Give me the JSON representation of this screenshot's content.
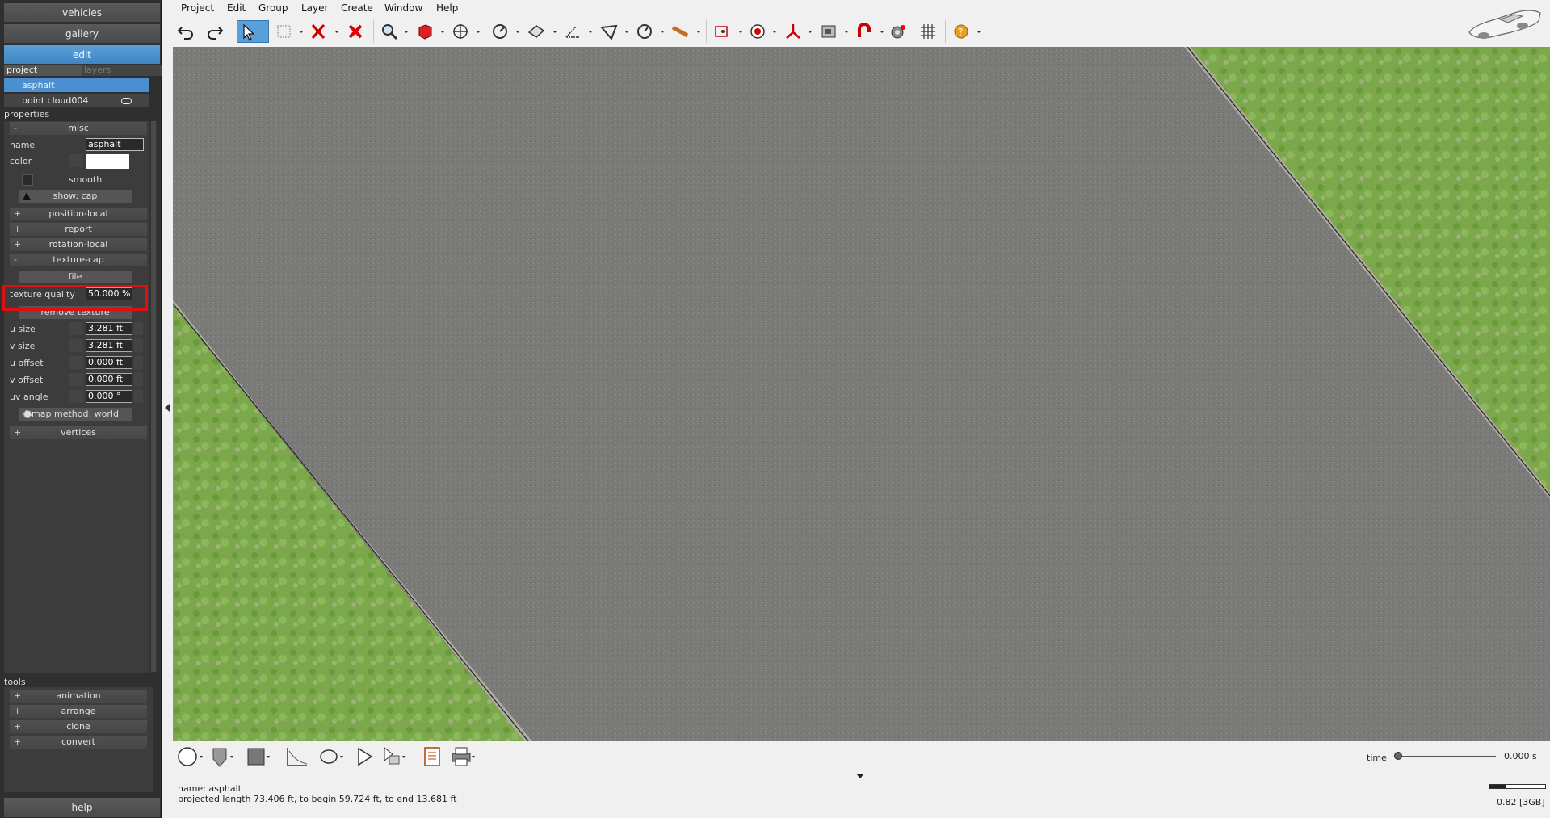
{
  "left_panel": {
    "top_buttons": [
      "vehicles",
      "gallery",
      "edit"
    ],
    "tabs": {
      "project": "project",
      "layers": "layers"
    },
    "layers": [
      "asphalt",
      "point cloud004"
    ],
    "properties_header": "properties",
    "misc_header": "misc",
    "name_label": "name",
    "name_value": "asphalt",
    "color_label": "color",
    "color_value": "#ffffff",
    "smooth_label": "smooth",
    "show_cap": "show: cap",
    "sections": [
      "position-local",
      "report",
      "rotation-local",
      "texture-cap"
    ],
    "file_button": "file",
    "texture_quality_label": "texture quality",
    "texture_quality_value": "50.000 %",
    "remove_texture": "remove texture",
    "fields": [
      {
        "label": "u size",
        "value": "3.281 ft"
      },
      {
        "label": "v size",
        "value": "3.281 ft"
      },
      {
        "label": "u offset",
        "value": "0.000 ft"
      },
      {
        "label": "v offset",
        "value": "0.000 ft"
      },
      {
        "label": "uv angle",
        "value": "0.000 °"
      }
    ],
    "map_method": "map method: world",
    "vertices": "vertices",
    "tools_header": "tools",
    "tools": [
      "animation",
      "arrange",
      "clone",
      "convert"
    ],
    "help": "help",
    "plus": "+",
    "minus": "-"
  },
  "menu": [
    "Project",
    "Edit",
    "Group",
    "Layer",
    "Create",
    "Window",
    "Help"
  ],
  "status": {
    "name_line": "name: asphalt",
    "length_line": "projected length 73.406 ft, to begin 59.724 ft, to end 13.681 ft"
  },
  "time": {
    "label": "time",
    "value": "0.000 s"
  },
  "memory": "0.82 [3GB]",
  "colors": {
    "accent": "#4a90d0",
    "highlight": "#e01010",
    "asphalt": "#7a7a78",
    "grass": "#7aa84a"
  }
}
